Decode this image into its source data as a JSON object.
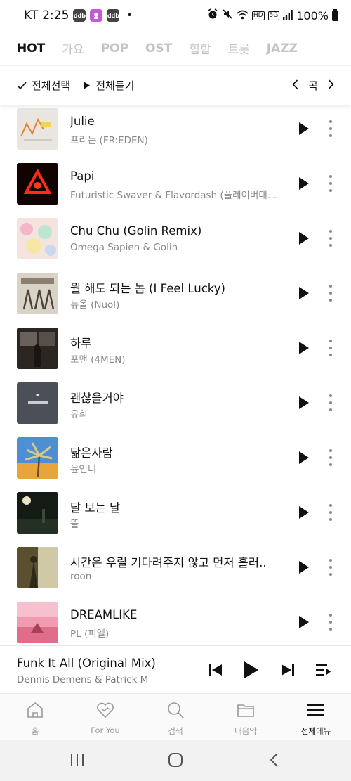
{
  "status_bar": {
    "carrier": "KT",
    "time": "2:25",
    "app_badges": [
      "ddb",
      "ddb"
    ],
    "dot": "•",
    "hd": "HD",
    "network": "5G",
    "battery": "100%"
  },
  "genre_tabs": [
    "HOT",
    "가요",
    "POP",
    "OST",
    "힙합",
    "트롯",
    "JAZZ"
  ],
  "controls": {
    "select_all": "전체선택",
    "listen_all": "전체듣기",
    "sort_label": "곡"
  },
  "songs": [
    {
      "title": "Julie",
      "artist": "프리든 (FR:EDEN)"
    },
    {
      "title": "Papi",
      "artist": "Futuristic Swaver & Flavordash (플레이버대시)..."
    },
    {
      "title": "Chu Chu (Golin Remix)",
      "artist": "Omega Sapien & Golin"
    },
    {
      "title": "뭘 해도 되는 놈 (I Feel Lucky)",
      "artist": "뉴올 (Nuol)"
    },
    {
      "title": "하루",
      "artist": "포맨 (4MEN)"
    },
    {
      "title": "괜찮을거야",
      "artist": "유희"
    },
    {
      "title": "닮은사람",
      "artist": "윤언니"
    },
    {
      "title": "달 보는 날",
      "artist": "뜰"
    },
    {
      "title": "시간은 우릴 기다려주지 않고 먼저 흘러..",
      "artist": "roon"
    },
    {
      "title": "DREAMLIKE",
      "artist": "PL (피엘)"
    }
  ],
  "mini_player": {
    "title": "Funk It All (Original Mix)",
    "artist": "Dennis Demens & Patrick M"
  },
  "bottom_nav": [
    {
      "label": "홈",
      "icon": "home-icon"
    },
    {
      "label": "For You",
      "icon": "heart-icon"
    },
    {
      "label": "검색",
      "icon": "search-icon"
    },
    {
      "label": "내음악",
      "icon": "folder-icon"
    },
    {
      "label": "전체메뉴",
      "icon": "menu-icon"
    }
  ],
  "colors": {
    "text": "#111111",
    "muted": "#888888",
    "inactive_tab": "#c4c4c4"
  }
}
